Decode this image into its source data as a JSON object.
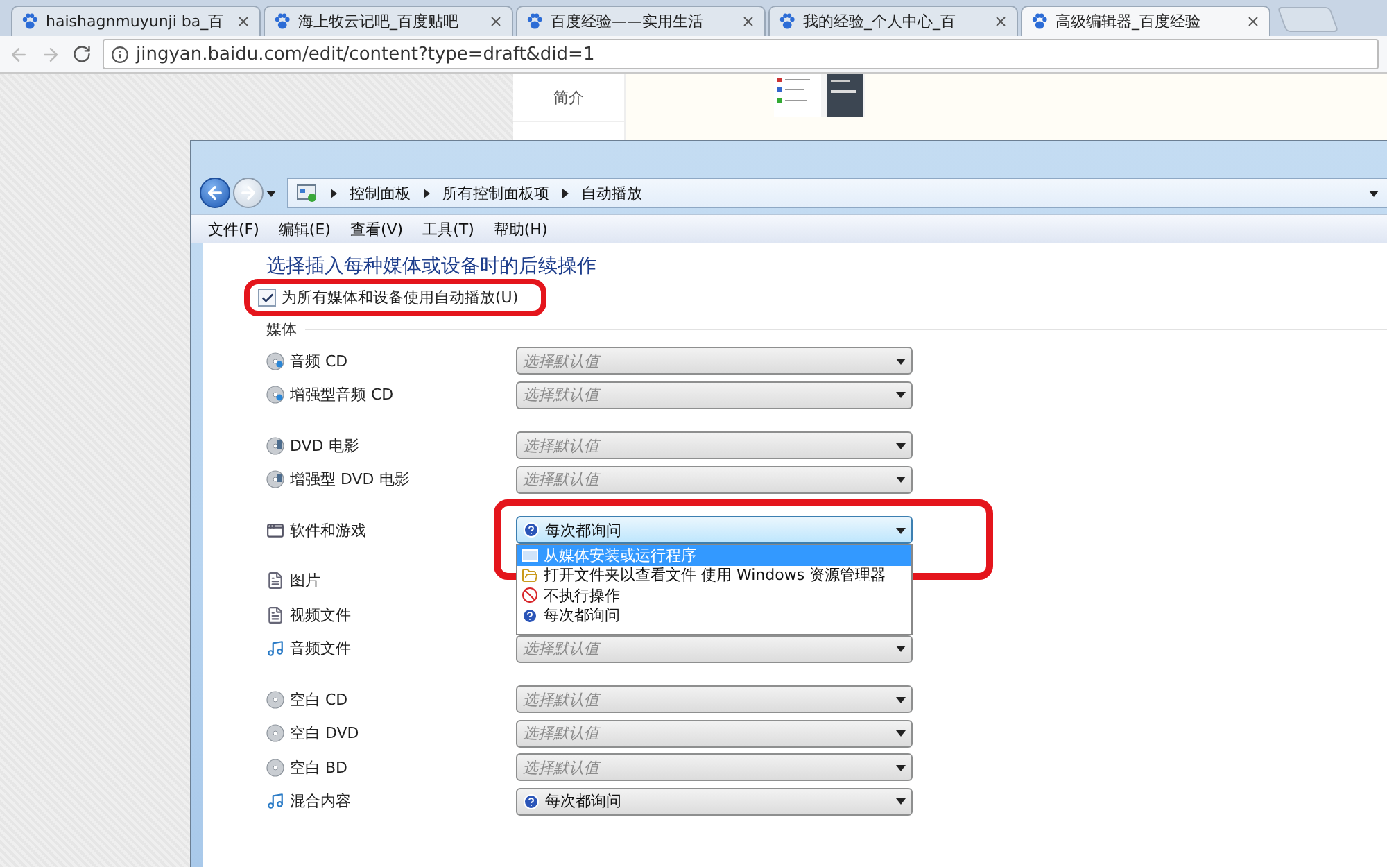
{
  "browser": {
    "tabs": [
      {
        "title": "haishagnmuyunji ba_百",
        "selected": false
      },
      {
        "title": "海上牧云记吧_百度贴吧",
        "selected": false
      },
      {
        "title": "百度经验——实用生活",
        "selected": false
      },
      {
        "title": "我的经验_个人中心_百",
        "selected": false
      },
      {
        "title": "高级编辑器_百度经验",
        "selected": true
      }
    ],
    "url": "jingyan.baidu.com/edit/content?type=draft&did=1"
  },
  "page_behind": {
    "menu": [
      "简介"
    ]
  },
  "window": {
    "breadcrumb": [
      "控制面板",
      "所有控制面板项",
      "自动播放"
    ],
    "menu": [
      "文件(F)",
      "编辑(E)",
      "查看(V)",
      "工具(T)",
      "帮助(H)"
    ],
    "heading": "选择插入每种媒体或设备时的后续操作",
    "autoplay_checkbox": {
      "label": "为所有媒体和设备使用自动播放(U)",
      "checked": true
    },
    "section": "媒体",
    "groups": [
      [
        {
          "label": "音频 CD",
          "kind": "audio-disc",
          "placeholder": "选择默认值"
        },
        {
          "label": "增强型音频 CD",
          "kind": "audio-disc",
          "placeholder": "选择默认值"
        }
      ],
      [
        {
          "label": "DVD 电影",
          "kind": "video-disc",
          "placeholder": "选择默认值"
        },
        {
          "label": "增强型 DVD 电影",
          "kind": "video-disc",
          "placeholder": "选择默认值"
        }
      ],
      [
        {
          "label": "软件和游戏",
          "kind": "program",
          "value": {
            "kind": "question",
            "label": "每次都询问"
          },
          "open": true,
          "options": [
            {
              "label": "从媒体安装或运行程序",
              "kind": "window",
              "selected": true
            },
            {
              "label": "打开文件夹以查看文件 使用 Windows 资源管理器",
              "kind": "folder",
              "selected": false
            },
            {
              "label": "不执行操作",
              "kind": "none",
              "selected": false
            },
            {
              "label": "每次都询问",
              "kind": "question",
              "selected": false
            }
          ]
        }
      ],
      [
        {
          "label": "图片",
          "kind": "file"
        },
        {
          "label": "视频文件",
          "kind": "file"
        },
        {
          "label": "音频文件",
          "kind": "music-file",
          "placeholder": "选择默认值"
        }
      ],
      [
        {
          "label": "空白 CD",
          "kind": "blank-disc",
          "placeholder": "选择默认值"
        },
        {
          "label": "空白 DVD",
          "kind": "blank-disc",
          "placeholder": "选择默认值"
        },
        {
          "label": "空白 BD",
          "kind": "blank-disc",
          "placeholder": "选择默认值"
        },
        {
          "label": "混合内容",
          "kind": "music-file",
          "value": {
            "kind": "question",
            "label": "每次都询问"
          }
        }
      ]
    ]
  }
}
